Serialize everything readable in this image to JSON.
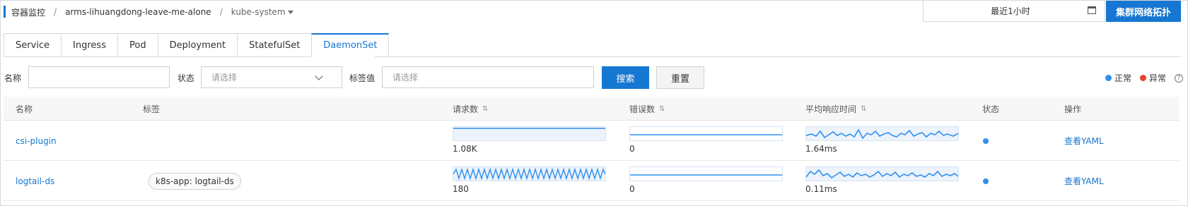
{
  "header": {
    "breadcrumb_root": "容器监控",
    "breadcrumb_app": "arms-lihuangdong-leave-me-alone",
    "breadcrumb_ns": "kube-system",
    "separator": "/",
    "time_range": "最近1小时",
    "topology_button": "集群网络拓扑"
  },
  "tabs": [
    {
      "label": "Service"
    },
    {
      "label": "Ingress"
    },
    {
      "label": "Pod"
    },
    {
      "label": "Deployment"
    },
    {
      "label": "StatefulSet"
    },
    {
      "label": "DaemonSet",
      "active": true
    }
  ],
  "filters": {
    "name_label": "名称",
    "name_value": "",
    "status_label": "状态",
    "status_placeholder": "请选择",
    "tag_label": "标签值",
    "tag_placeholder": "请选择",
    "search_button": "搜索",
    "reset_button": "重置"
  },
  "legend": {
    "normal": "正常",
    "abnormal": "异常",
    "help": "?",
    "normal_color": "#2e8ff0",
    "abnormal_color": "#e8402f"
  },
  "table": {
    "columns": {
      "name": "名称",
      "tags": "标签",
      "requests": "请求数",
      "errors": "错误数",
      "latency": "平均响应时间",
      "status": "状态",
      "actions": "操作"
    },
    "sort_glyph": "⇅",
    "rows": [
      {
        "name": "csi-plugin",
        "tag": "",
        "requests": "1.08K",
        "errors": "0",
        "latency": "1.64ms",
        "status": "normal",
        "action": "查看YAML"
      },
      {
        "name": "logtail-ds",
        "tag": "k8s-app: logtail-ds",
        "requests": "180",
        "errors": "0",
        "latency": "0.11ms",
        "status": "normal",
        "action": "查看YAML"
      }
    ]
  },
  "colors": {
    "accent": "#1677d2",
    "spark_line": "#2e8ff0"
  }
}
